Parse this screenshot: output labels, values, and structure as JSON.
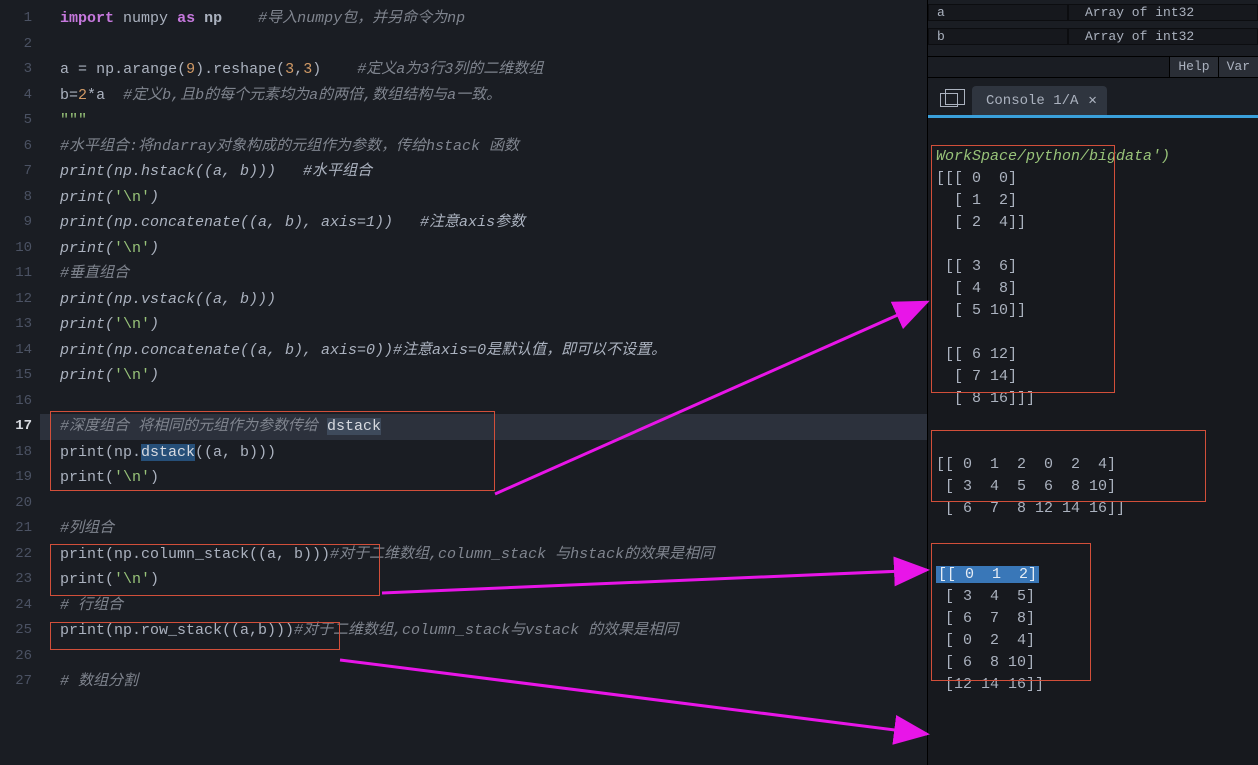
{
  "gutter": {
    "lines": [
      "1",
      "2",
      "3",
      "4",
      "5",
      "6",
      "7",
      "8",
      "9",
      "10",
      "11",
      "12",
      "13",
      "14",
      "15",
      "16",
      "17",
      "18",
      "19",
      "20",
      "21",
      "22",
      "23",
      "24",
      "25",
      "26",
      "27"
    ],
    "current_line": "17"
  },
  "code": {
    "l1": {
      "import": "import",
      "mod": "numpy",
      "as": "as",
      "alias": "np",
      "cmt": "#导入numpy包，并另命令为np"
    },
    "l3": {
      "a": "a",
      "eq": "=",
      "np": "np",
      "dot": ".",
      "arange": "arange",
      "open": "(",
      "n9": "9",
      "close": ")",
      "reshape": ".reshape(",
      "n3a": "3",
      "comma": ",",
      "n3b": "3",
      "close2": ")",
      "cmt": "#定义a为3行3列的二维数组"
    },
    "l4": {
      "b": "b",
      "eq": "=",
      "two": "2",
      "star": "*",
      "a": "a",
      "cmt": "#定义b,且b的每个元素均为a的两倍,数组结构与a一致。"
    },
    "l5": {
      "str": "\"\"\""
    },
    "l6": {
      "cmt": "#水平组合:将ndarray对象构成的元组作为参数，传给hstack 函数"
    },
    "l7": {
      "body": "print(np.hstack((a, b)))   #水平组合"
    },
    "l8": {
      "p": "print(",
      "s": "'\\n'",
      "c": ")"
    },
    "l9": {
      "body": "print(np.concatenate((a, b), axis=1))   #注意axis参数"
    },
    "l10": {
      "p": "print(",
      "s": "'\\n'",
      "c": ")"
    },
    "l11": {
      "cmt": "#垂直组合"
    },
    "l12": {
      "body": "print(np.vstack((a, b)))"
    },
    "l13": {
      "p": "print(",
      "s": "'\\n'",
      "c": ")"
    },
    "l14": {
      "body": "print(np.concatenate((a, b), axis=0))#注意axis=0是默认值，即可以不设置。"
    },
    "l15": {
      "p": "print(",
      "s": "'\\n'",
      "c": ")"
    },
    "l17": {
      "cmt_a": "#深度组合 将相同的元组作为参数传给 ",
      "sel": "dstack"
    },
    "l18": {
      "pre": "print(np.",
      "hl": "dstack",
      "post": "((a, b)))"
    },
    "l19": {
      "p": "print(",
      "s": "'\\n'",
      "c": ")"
    },
    "l21": {
      "cmt": "#列组合"
    },
    "l22": {
      "pre": "print(np.column_stack((a, b)))",
      "cmt": "#对于二维数组,column_stack 与hstack的效果是相同"
    },
    "l23": {
      "p": "print(",
      "s": "'\\n'",
      "c": ")"
    },
    "l24": {
      "cmt": "# 行组合"
    },
    "l25": {
      "pre": "print(np.row_stack((a,b)))",
      "cmt": "#对于二维数组,column_stack与vstack 的效果是相同"
    },
    "l27": {
      "cmt": "# 数组分割"
    }
  },
  "var_explorer": {
    "rows": [
      {
        "name": "a",
        "type": "Array of int32"
      },
      {
        "name": "b",
        "type": "Array of int32"
      }
    ]
  },
  "help_tabs": {
    "help": "Help",
    "var": "Var"
  },
  "console": {
    "tab_label": "Console 1/A",
    "tab_close": "✕",
    "path": "WorkSpace/python/bigdata')",
    "out1": "[[[ 0  0]\n  [ 1  2]\n  [ 2  4]]\n\n [[ 3  6]\n  [ 4  8]\n  [ 5 10]]\n\n [[ 6 12]\n  [ 7 14]\n  [ 8 16]]]",
    "out2": "[[ 0  1  2  0  2  4]\n [ 3  4  5  6  8 10]\n [ 6  7  8 12 14 16]]",
    "out3_row1": "[[ 0  1  2]",
    "out3_rest": " [ 3  4  5]\n [ 6  7  8]\n [ 0  2  4]\n [ 6  8 10]\n [12 14 16]]"
  }
}
